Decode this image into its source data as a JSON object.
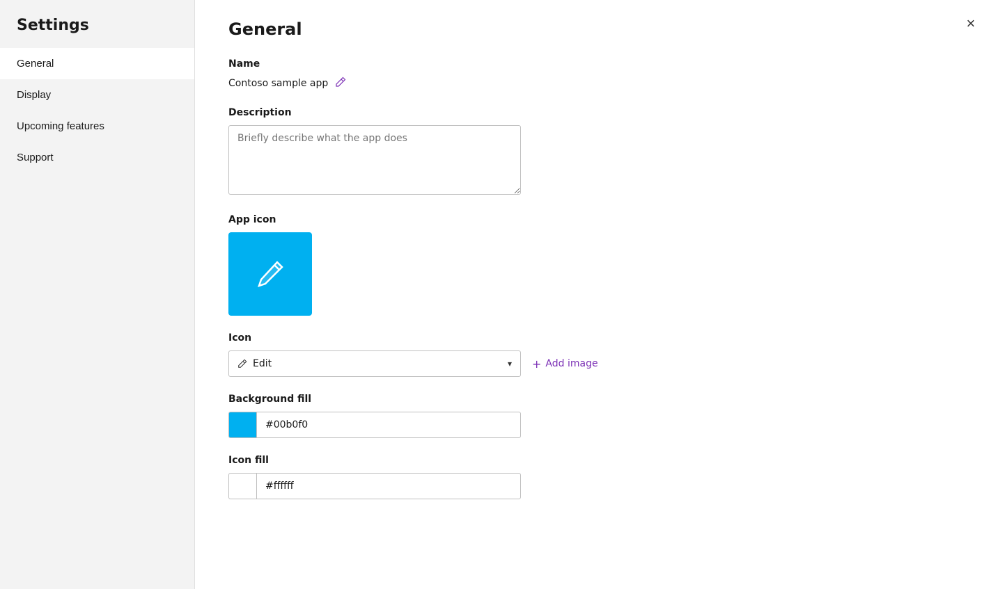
{
  "sidebar": {
    "title": "Settings",
    "items": [
      {
        "id": "general",
        "label": "General",
        "active": true
      },
      {
        "id": "display",
        "label": "Display",
        "active": false
      },
      {
        "id": "upcoming-features",
        "label": "Upcoming features",
        "active": false
      },
      {
        "id": "support",
        "label": "Support",
        "active": false
      }
    ]
  },
  "main": {
    "title": "General",
    "sections": {
      "name": {
        "label": "Name",
        "value": "Contoso sample app",
        "edit_icon": "✏"
      },
      "description": {
        "label": "Description",
        "placeholder": "Briefly describe what the app does"
      },
      "app_icon": {
        "label": "App icon",
        "background_color": "#00b0f0"
      },
      "icon": {
        "label": "Icon",
        "dropdown_value": "Edit",
        "add_image_label": "+ Add image"
      },
      "background_fill": {
        "label": "Background fill",
        "color": "#00b0f0",
        "value": "#00b0f0"
      },
      "icon_fill": {
        "label": "Icon fill",
        "color": "#ffffff",
        "value": "#ffffff"
      }
    }
  },
  "close_button": "×"
}
